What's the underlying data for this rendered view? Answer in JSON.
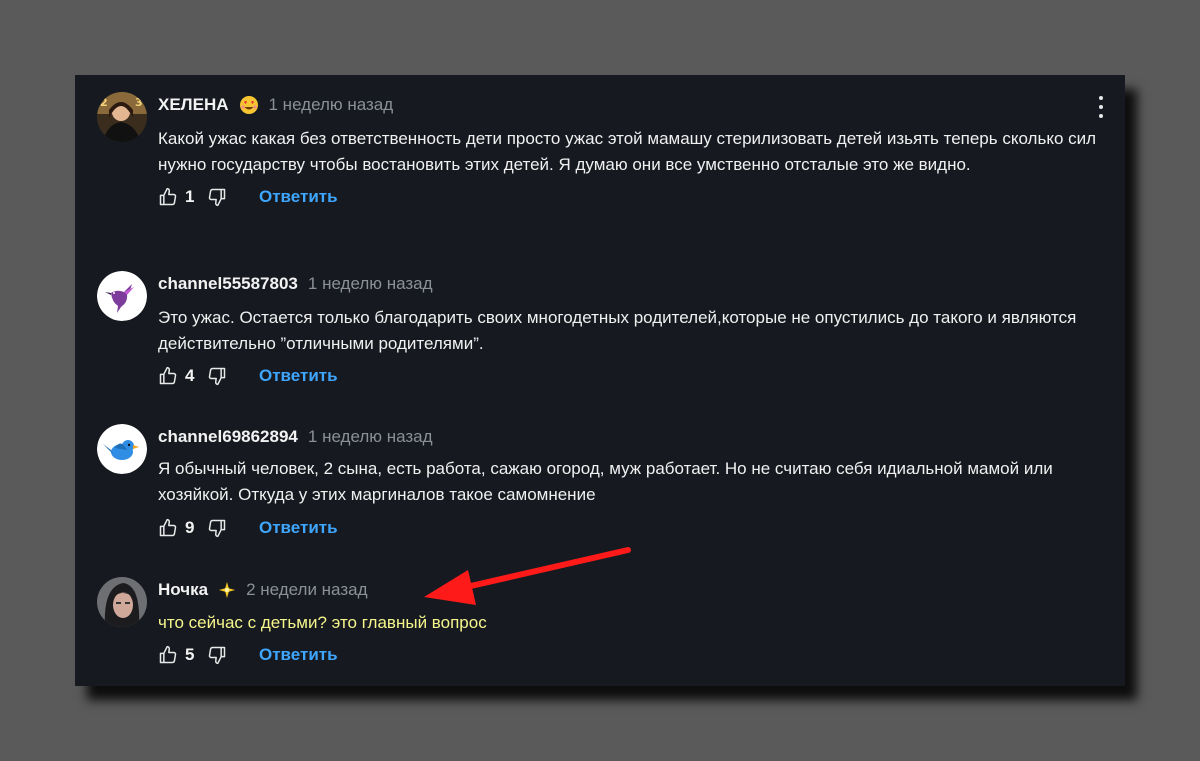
{
  "comments": [
    {
      "author": "ХЕЛЕНА",
      "badge_icon": "heart-eyes-emoji",
      "time": "1 неделю назад",
      "text": "Какой ужас какая  без ответственность  дети просто ужас  этой мамашу стерилизовать  детей изьять  теперь сколько  сил нужно  государству чтобы  востановить  этих  детей. Я думаю  они все  умственно  отсталые  это же видно.",
      "likes": "1",
      "reply_label": "Ответить",
      "avatar_icon": "avatar-photo"
    },
    {
      "author": "channel55587803",
      "time": "1 неделю назад",
      "text": "Это ужас. Остается только благодарить своих многодетных родителей,которые не опустились до такого и являются  действительно ”отличными родителями”.",
      "likes": "4",
      "reply_label": "Ответить",
      "avatar_icon": "hummingbird-icon"
    },
    {
      "author": "channel69862894",
      "time": "1 неделю назад",
      "text": "Я обычный человек, 2 сына, есть работа, сажаю огород, муж работает. Но не считаю себя идиальной мамой или хозяйкой. Откуда у этих маргиналов такое самомнение",
      "likes": "9",
      "reply_label": "Ответить",
      "avatar_icon": "bluebird-icon"
    },
    {
      "author": "Ночка",
      "badge_icon": "sparkle-star-emoji",
      "time": "2 недели назад",
      "text": "что сейчас с детьми? это главный вопрос",
      "likes": "5",
      "reply_label": "Ответить",
      "avatar_icon": "avatar-photo"
    }
  ],
  "colors": {
    "panel_bg": "#161a20",
    "page_bg": "#5a5a5a",
    "reply_blue": "#3ea6ff",
    "highlight_text": "#f5f58c",
    "annotation_arrow": "#ff1a1a"
  }
}
